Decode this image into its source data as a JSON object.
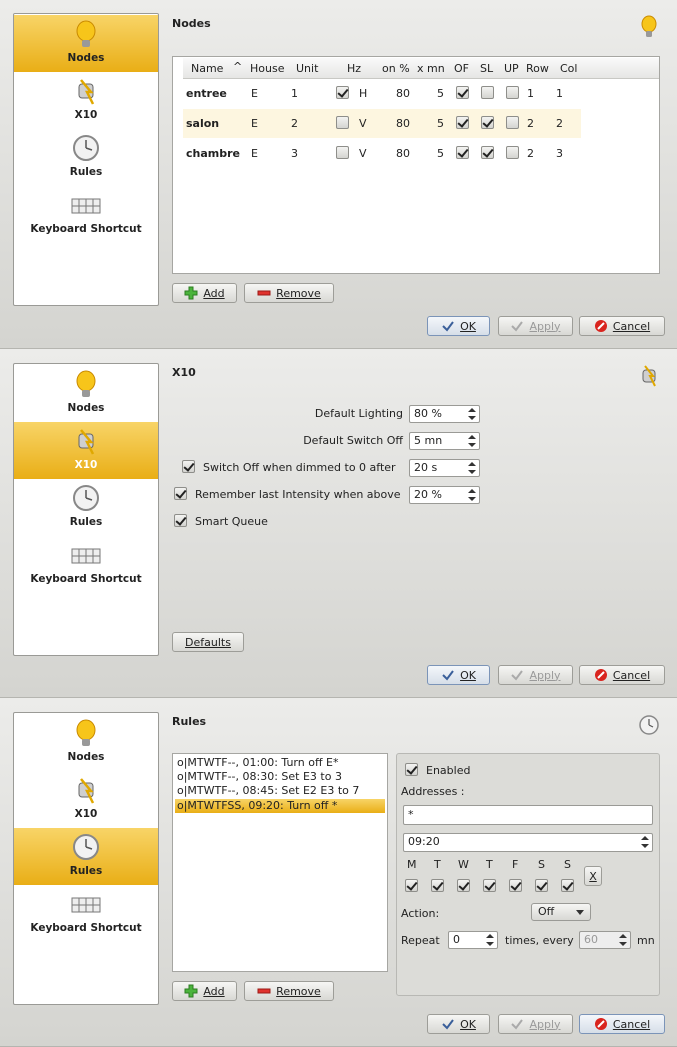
{
  "panels": {
    "nodes": {
      "sidebar": [
        "Nodes",
        "X10",
        "Rules",
        "Keyboard Shortcut"
      ],
      "title": "Nodes",
      "columns": [
        "Name",
        "House",
        "Unit",
        "Hz",
        "on %",
        "x mn",
        "OF",
        "SL",
        "UP",
        "Row",
        "Col"
      ],
      "rows": [
        {
          "name": "entree",
          "house": "E",
          "unit": "1",
          "hz_checked": true,
          "hz": "H",
          "on": "80",
          "xmn": "5",
          "of": true,
          "sl": false,
          "up": false,
          "row": "1",
          "col": "1"
        },
        {
          "name": "salon",
          "house": "E",
          "unit": "2",
          "hz_checked": false,
          "hz": "V",
          "on": "80",
          "xmn": "5",
          "of": true,
          "sl": true,
          "up": false,
          "row": "2",
          "col": "2"
        },
        {
          "name": "chambre",
          "house": "E",
          "unit": "3",
          "hz_checked": false,
          "hz": "V",
          "on": "80",
          "xmn": "5",
          "of": true,
          "sl": true,
          "up": false,
          "row": "2",
          "col": "3"
        }
      ],
      "add_label": "Add",
      "remove_label": "Remove"
    },
    "x10": {
      "title": "X10",
      "default_lighting_label": "Default Lighting",
      "default_lighting_value": "80 %",
      "default_switch_off_label": "Default Switch Off",
      "default_switch_off_value": "5 mn",
      "switch_off_dimmed_label": "Switch Off when dimmed to 0 after",
      "switch_off_dimmed_value": "20 s",
      "remember_label": "Remember last Intensity when above",
      "remember_value": "20 %",
      "smart_queue_label": "Smart Queue",
      "defaults_label": "Defaults"
    },
    "rules": {
      "title": "Rules",
      "items": [
        "o|MTWTF--, 01:00: Turn off E*",
        "o|MTWTF--, 08:30: Set E3 to 3",
        "o|MTWTF--, 08:45: Set E2 E3 to 7",
        "o|MTWTFSS, 09:20: Turn off *"
      ],
      "enabled_label": "Enabled",
      "addresses_label": "Addresses :",
      "addresses_value": "*",
      "time_value": "09:20",
      "days": [
        "M",
        "T",
        "W",
        "T",
        "F",
        "S",
        "S"
      ],
      "clear_label": "X",
      "action_label": "Action:",
      "action_value": "Off",
      "repeat_label": "Repeat",
      "repeat_value": "0",
      "times_every_label": "times, every",
      "every_value": "60",
      "mn_label": "mn",
      "add_label": "Add",
      "remove_label": "Remove"
    }
  },
  "buttons": {
    "ok": "OK",
    "apply": "Apply",
    "cancel": "Cancel"
  }
}
